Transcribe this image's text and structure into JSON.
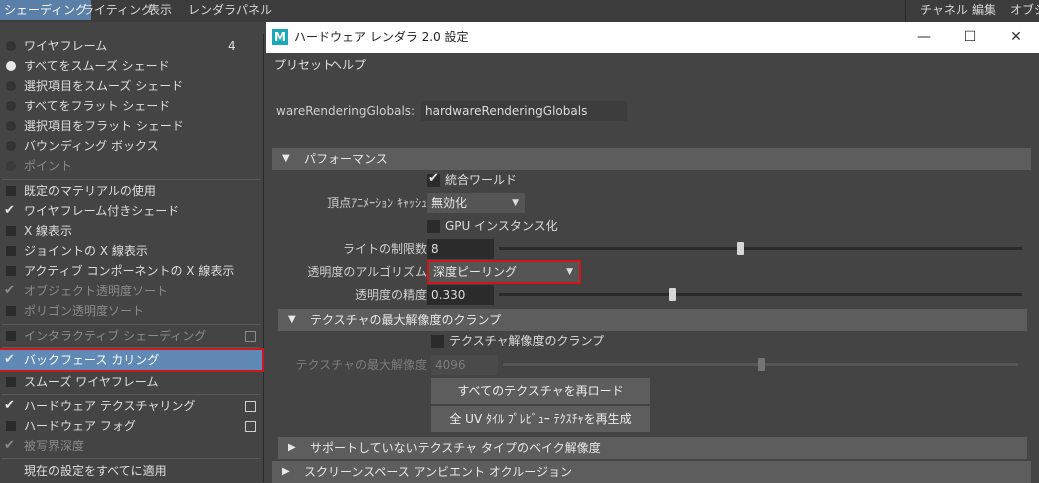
{
  "menubar": {
    "items": [
      "シェーディング",
      "ライティング",
      "表示",
      "レンダラ",
      "パネル"
    ],
    "right_items": [
      "チャネル",
      "編集",
      "オブジ"
    ]
  },
  "shading_menu": {
    "items": [
      {
        "label": "ワイヤフレーム",
        "kind": "radio",
        "state": "off",
        "shortcut": "4"
      },
      {
        "label": "すべてをスムーズ シェード",
        "kind": "radio",
        "state": "on"
      },
      {
        "label": "選択項目をスムーズ シェード",
        "kind": "radio",
        "state": "off"
      },
      {
        "label": "すべてをフラット シェード",
        "kind": "radio",
        "state": "off"
      },
      {
        "label": "選択項目をフラット シェード",
        "kind": "radio",
        "state": "off"
      },
      {
        "label": "バウンディング ボックス",
        "kind": "radio",
        "state": "off"
      },
      {
        "label": "ポイント",
        "kind": "radio",
        "state": "disabled"
      },
      {
        "label": "既定のマテリアルの使用",
        "kind": "check",
        "state": "off"
      },
      {
        "label": "ワイヤフレーム付きシェード",
        "kind": "check",
        "state": "on"
      },
      {
        "label": "X 線表示",
        "kind": "check",
        "state": "off"
      },
      {
        "label": "ジョイントの X 線表示",
        "kind": "check",
        "state": "off"
      },
      {
        "label": "アクティブ コンポーネントの X 線表示",
        "kind": "check",
        "state": "off"
      },
      {
        "label": "オブジェクト透明度ソート",
        "kind": "check",
        "state": "on-disabled"
      },
      {
        "label": "ポリゴン透明度ソート",
        "kind": "check",
        "state": "disabled"
      },
      {
        "label": "インタラクティブ シェーディング",
        "kind": "check",
        "state": "disabled"
      },
      {
        "label": "バックフェース カリング",
        "kind": "check",
        "state": "on"
      },
      {
        "label": "スムーズ ワイヤフレーム",
        "kind": "check",
        "state": "off"
      },
      {
        "label": "ハードウェア テクスチャリング",
        "kind": "check",
        "state": "on"
      },
      {
        "label": "ハードウェア フォグ",
        "kind": "check",
        "state": "off"
      },
      {
        "label": "被写界深度",
        "kind": "check",
        "state": "on-disabled"
      },
      {
        "label": "現在の設定をすべてに適用",
        "kind": "action",
        "state": "off"
      }
    ]
  },
  "window": {
    "title": "ハードウェア レンダラ 2.0 設定",
    "logo": "M",
    "controls": [
      "—",
      "☐",
      "✕"
    ],
    "menu": [
      "プリセット",
      "ヘルプ"
    ],
    "globals_label": "wareRenderingGlobals:",
    "globals_value": "hardwareRenderingGlobals",
    "performance": {
      "title": "パフォーマンス",
      "consolidate_world": "統合ワールド",
      "vertex_anim_cache_label": "頂点ｱﾆﾒｰｼｮﾝ ｷｬｯｼｭ",
      "vertex_anim_cache_value": "無効化",
      "gpu_instancing": "GPU インスタンス化",
      "light_limit_label": "ライトの制限数",
      "light_limit_value": "8",
      "light_limit_slider": 0.46,
      "transparency_algo_label": "透明度のアルゴリズム",
      "transparency_algo_value": "深度ピーリング",
      "transparency_quality_label": "透明度の精度",
      "transparency_quality_value": "0.330",
      "transparency_quality_slider": 0.33
    },
    "texture_clamp": {
      "title": "テクスチャの最大解像度のクランプ",
      "clamp_label": "テクスチャ解像度のクランプ",
      "max_res_label": "テクスチャの最大解像度",
      "max_res_value": "4096",
      "max_res_slider": 0.5,
      "reload_button": "すべてのテクスチャを再ロード",
      "regen_button": "全 UV ﾀｲﾙ ﾌﾟﾚﾋﾞｭｰ ﾃｸｽﾁｬを再生成"
    },
    "section_bake": "サポートしていないテクスチャ タイプのベイク解像度",
    "section_ssao": "スクリーンスペース アンビエント オクルージョン"
  },
  "colors": {
    "menu_active": "#5a7fa8",
    "selection": "#5e8ab5",
    "highlight_red": "#d0151b",
    "maya_logo": "#1aa9b6"
  }
}
